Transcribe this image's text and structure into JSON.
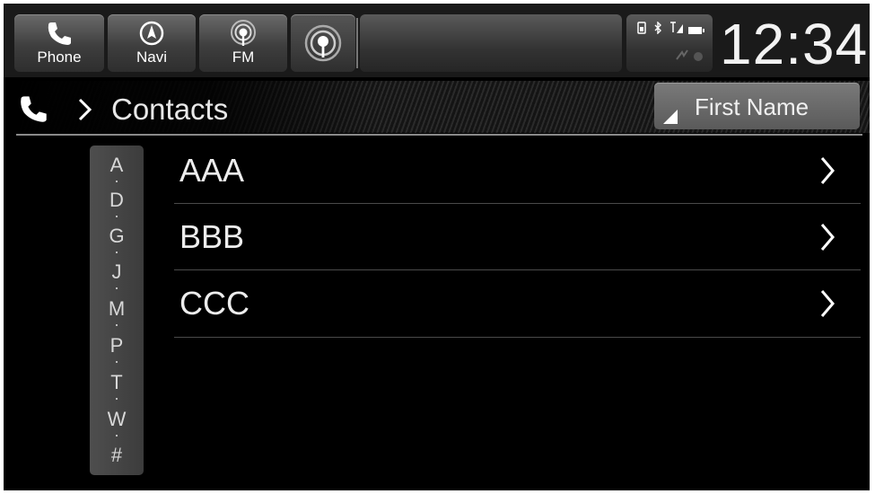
{
  "shortcuts": [
    {
      "label": "Phone",
      "icon": "phone-icon"
    },
    {
      "label": "Navi",
      "icon": "compass-icon"
    },
    {
      "label": "FM",
      "icon": "radio-fm-icon"
    }
  ],
  "source": {
    "icon": "radio-fm-active-icon",
    "icon_label": "FM"
  },
  "status": {
    "icons": [
      "phone-battery-icon",
      "bluetooth-icon",
      "signal-icon",
      "battery-icon",
      "data-icon"
    ]
  },
  "clock": "12:34",
  "header": {
    "breadcrumb_icon": "phone-icon",
    "separator_icon": "chevron-right-icon",
    "title": "Contacts",
    "sort_label": "First Name"
  },
  "alphabet": [
    "A",
    "D",
    "G",
    "J",
    "M",
    "P",
    "T",
    "W",
    "#"
  ],
  "contacts": [
    {
      "name": "AAA"
    },
    {
      "name": "BBB"
    },
    {
      "name": "CCC"
    }
  ],
  "colors": {
    "background": "#000000",
    "text": "#ededed",
    "button": "#5a5a5a"
  }
}
